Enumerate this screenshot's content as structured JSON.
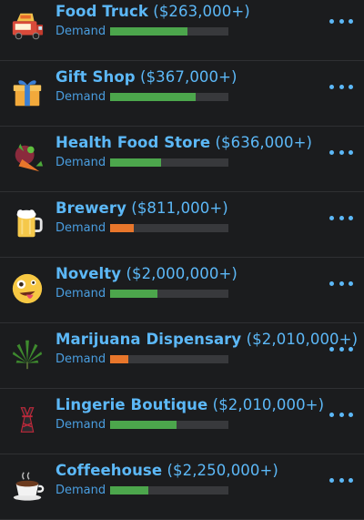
{
  "demand_label": "Demand",
  "colors": {
    "accent": "#5cb8f7",
    "demand_high": "#4ca64c",
    "demand_low": "#e8762b"
  },
  "businesses": [
    {
      "name": "Food Truck",
      "price": "($263,000+)",
      "icon": "food-truck-icon",
      "demand": 0.65,
      "demand_color": "#4ca64c"
    },
    {
      "name": "Gift Shop",
      "price": "($367,000+)",
      "icon": "gift-box-icon",
      "demand": 0.72,
      "demand_color": "#4ca64c"
    },
    {
      "name": "Health Food Store",
      "price": "($636,000+)",
      "icon": "vegetables-icon",
      "demand": 0.43,
      "demand_color": "#4ca64c"
    },
    {
      "name": "Brewery",
      "price": "($811,000+)",
      "icon": "beer-mug-icon",
      "demand": 0.2,
      "demand_color": "#e8762b"
    },
    {
      "name": "Novelty",
      "price": "($2,000,000+)",
      "icon": "zany-face-icon",
      "demand": 0.4,
      "demand_color": "#4ca64c"
    },
    {
      "name": "Marijuana Dispensary",
      "price": "($2,010,000+)",
      "icon": "cannabis-leaf-icon",
      "demand": 0.15,
      "demand_color": "#e8762b"
    },
    {
      "name": "Lingerie Boutique",
      "price": "($2,010,000+)",
      "icon": "lingerie-icon",
      "demand": 0.56,
      "demand_color": "#4ca64c"
    },
    {
      "name": "Coffeehouse",
      "price": "($2,250,000+)",
      "icon": "coffee-cup-icon",
      "demand": 0.32,
      "demand_color": "#4ca64c"
    }
  ]
}
